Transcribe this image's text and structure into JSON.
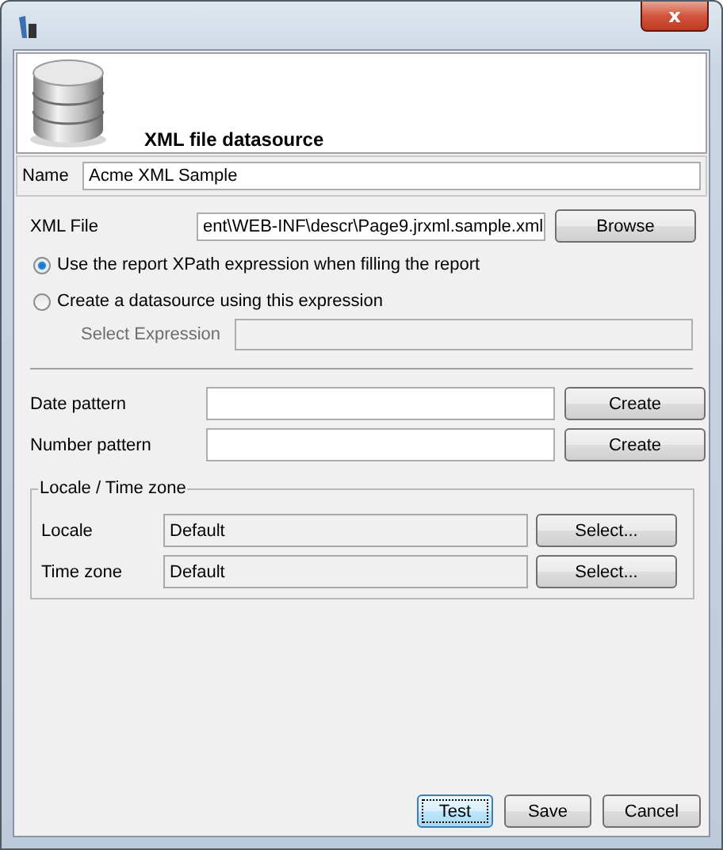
{
  "window": {
    "title_bar_close": "x"
  },
  "header": {
    "title": "XML file datasource"
  },
  "name_field": {
    "label": "Name",
    "value": "Acme XML Sample"
  },
  "xml_file": {
    "label": "XML File",
    "value": "ent\\WEB-INF\\descr\\Page9.jrxml.sample.xml",
    "button": "Browse"
  },
  "options": [
    {
      "label": "Use the report XPath expression when filling the report",
      "selected": true
    },
    {
      "label": "Create a datasource using this expression",
      "selected": false
    }
  ],
  "select_expression": {
    "label": "Select Expression",
    "disabled": true
  },
  "patterns": [
    {
      "label": "Date pattern",
      "button": "Create"
    },
    {
      "label": "Number pattern",
      "button": "Create"
    }
  ],
  "locale_group": {
    "title": "Locale / Time zone",
    "rows": [
      {
        "label": "Locale",
        "value": "Default",
        "button": "Select..."
      },
      {
        "label": "Time zone",
        "value": "Default",
        "button": "Select..."
      }
    ]
  },
  "buttons": [
    {
      "label": "Test",
      "focused": true
    },
    {
      "label": "Save",
      "focused": false
    },
    {
      "label": "Cancel",
      "focused": false
    }
  ]
}
